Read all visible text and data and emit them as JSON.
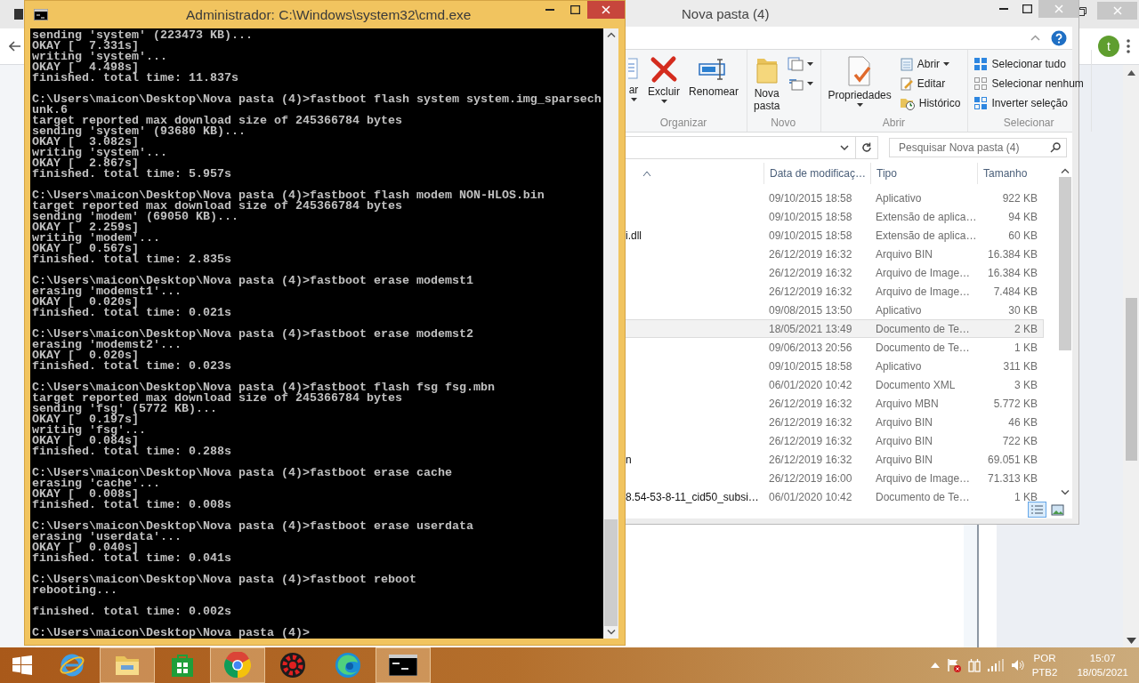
{
  "browser": {
    "avatar": "t"
  },
  "explorer": {
    "title": "Nova pasta (4)",
    "ribbon": [
      {
        "label": "Organizar",
        "items": [
          {
            "kind": "partial",
            "label": "ar",
            "dropdown": true
          },
          {
            "kind": "delete",
            "label": "Excluir",
            "dropdown": true
          },
          {
            "kind": "rename",
            "label": "Renomear",
            "dropdown": false
          }
        ]
      },
      {
        "label": "Novo",
        "items": [
          {
            "kind": "new-folder",
            "label": "Nova pasta",
            "dropdown": false
          },
          {
            "kind": "new-item",
            "dropdown": true
          },
          {
            "kind": "easy-access",
            "dropdown": true
          }
        ]
      },
      {
        "label": "Abrir",
        "items": [
          {
            "kind": "properties",
            "label": "Propriedades",
            "dropdown": true
          },
          {
            "kind": "open",
            "label": "Abrir",
            "dropdown": true
          },
          {
            "kind": "edit",
            "label": "Editar",
            "dropdown": false
          },
          {
            "kind": "history",
            "label": "Histórico",
            "dropdown": false
          }
        ]
      },
      {
        "label": "Selecionar",
        "items": [
          {
            "kind": "select-all",
            "label": "Selecionar tudo",
            "dropdown": false
          },
          {
            "kind": "select-none",
            "label": "Selecionar nenhum",
            "dropdown": false
          },
          {
            "kind": "invert",
            "label": "Inverter seleção",
            "dropdown": false
          }
        ]
      }
    ],
    "search": {
      "placeholder": "Pesquisar Nova pasta (4)"
    },
    "name_sorted": true,
    "columns": [
      "Data de modificaç…",
      "Tipo",
      "Tamanho"
    ],
    "rows": [
      {
        "date": "09/10/2015 18:58",
        "type": "Aplicativo",
        "size": "922 KB",
        "highlighted": false
      },
      {
        "date": "09/10/2015 18:58",
        "type": "Extensão de aplica…",
        "size": "94 KB",
        "highlighted": false
      },
      {
        "name": "i.dll",
        "date": "09/10/2015 18:58",
        "type": "Extensão de aplica…",
        "size": "60 KB",
        "highlighted": false
      },
      {
        "date": "26/12/2019 16:32",
        "type": "Arquivo BIN",
        "size": "16.384 KB",
        "highlighted": false
      },
      {
        "date": "26/12/2019 16:32",
        "type": "Arquivo de Image…",
        "size": "16.384 KB",
        "highlighted": false
      },
      {
        "date": "26/12/2019 16:32",
        "type": "Arquivo de Image…",
        "size": "7.484 KB",
        "highlighted": false
      },
      {
        "date": "09/08/2015 13:50",
        "type": "Aplicativo",
        "size": "30 KB",
        "highlighted": false
      },
      {
        "date": "18/05/2021 13:49",
        "type": "Documento de Te…",
        "size": "2 KB",
        "highlighted": true
      },
      {
        "date": "09/06/2013 20:56",
        "type": "Documento de Te…",
        "size": "1 KB",
        "highlighted": false
      },
      {
        "date": "09/10/2015 18:58",
        "type": "Aplicativo",
        "size": "311 KB",
        "highlighted": false
      },
      {
        "date": "06/01/2020 10:42",
        "type": "Documento XML",
        "size": "3 KB",
        "highlighted": false
      },
      {
        "date": "26/12/2019 16:32",
        "type": "Arquivo MBN",
        "size": "5.772 KB",
        "highlighted": false
      },
      {
        "date": "26/12/2019 16:32",
        "type": "Arquivo BIN",
        "size": "46 KB",
        "highlighted": false
      },
      {
        "date": "26/12/2019 16:32",
        "type": "Arquivo BIN",
        "size": "722 KB",
        "highlighted": false
      },
      {
        "name": "n",
        "date": "26/12/2019 16:32",
        "type": "Arquivo BIN",
        "size": "69.051 KB",
        "highlighted": false
      },
      {
        "date": "26/12/2019 16:00",
        "type": "Arquivo de Image…",
        "size": "71.313 KB",
        "highlighted": false
      },
      {
        "name": "8.54-53-8-11_cid50_subsi…",
        "date": "06/01/2020 10:42",
        "type": "Documento de Te…",
        "size": "1 KB",
        "highlighted": false
      }
    ],
    "views": [
      {
        "kind": "details",
        "selected": true
      },
      {
        "kind": "thumbnails",
        "selected": false
      }
    ]
  },
  "cmd": {
    "title": "Administrador: C:\\Windows\\system32\\cmd.exe",
    "blocks": [
      [
        "sending 'system' (223473 KB)...",
        "OKAY [  7.331s]",
        "writing 'system'...",
        "OKAY [  4.498s]",
        "finished. total time: 11.837s"
      ],
      [
        "C:\\Users\\maicon\\Desktop\\Nova pasta (4)>fastboot flash system system.img_sparsech",
        "unk.6",
        "target reported max download size of 245366784 bytes",
        "sending 'system' (93680 KB)...",
        "OKAY [  3.082s]",
        "writing 'system'...",
        "OKAY [  2.867s]",
        "finished. total time: 5.957s"
      ],
      [
        "C:\\Users\\maicon\\Desktop\\Nova pasta (4)>fastboot flash modem NON-HLOS.bin",
        "target reported max download size of 245366784 bytes",
        "sending 'modem' (69050 KB)...",
        "OKAY [  2.259s]",
        "writing 'modem'...",
        "OKAY [  0.567s]",
        "finished. total time: 2.835s"
      ],
      [
        "C:\\Users\\maicon\\Desktop\\Nova pasta (4)>fastboot erase modemst1",
        "erasing 'modemst1'...",
        "OKAY [  0.020s]",
        "finished. total time: 0.021s"
      ],
      [
        "C:\\Users\\maicon\\Desktop\\Nova pasta (4)>fastboot erase modemst2",
        "erasing 'modemst2'...",
        "OKAY [  0.020s]",
        "finished. total time: 0.023s"
      ],
      [
        "C:\\Users\\maicon\\Desktop\\Nova pasta (4)>fastboot flash fsg fsg.mbn",
        "target reported max download size of 245366784 bytes",
        "sending 'fsg' (5772 KB)...",
        "OKAY [  0.197s]",
        "writing 'fsg'...",
        "OKAY [  0.084s]",
        "finished. total time: 0.288s"
      ],
      [
        "C:\\Users\\maicon\\Desktop\\Nova pasta (4)>fastboot erase cache",
        "erasing 'cache'...",
        "OKAY [  0.008s]",
        "finished. total time: 0.008s"
      ],
      [
        "C:\\Users\\maicon\\Desktop\\Nova pasta (4)>fastboot erase userdata",
        "erasing 'userdata'...",
        "OKAY [  0.040s]",
        "finished. total time: 0.041s"
      ],
      [
        "C:\\Users\\maicon\\Desktop\\Nova pasta (4)>fastboot reboot",
        "rebooting..."
      ],
      [
        "finished. total time: 0.002s"
      ],
      [
        "C:\\Users\\maicon\\Desktop\\Nova pasta (4)>"
      ]
    ]
  },
  "taskbar": {
    "apps": [
      {
        "kind": "ie",
        "running": false
      },
      {
        "kind": "explorer",
        "running": true
      },
      {
        "kind": "store",
        "running": false
      },
      {
        "kind": "chrome",
        "running": true
      },
      {
        "kind": "gear-app",
        "running": false
      },
      {
        "kind": "edge",
        "running": false
      },
      {
        "kind": "cmd",
        "running": true
      }
    ],
    "language": [
      "POR",
      "PTB2"
    ],
    "time": "15:07",
    "date": "18/05/2021"
  }
}
